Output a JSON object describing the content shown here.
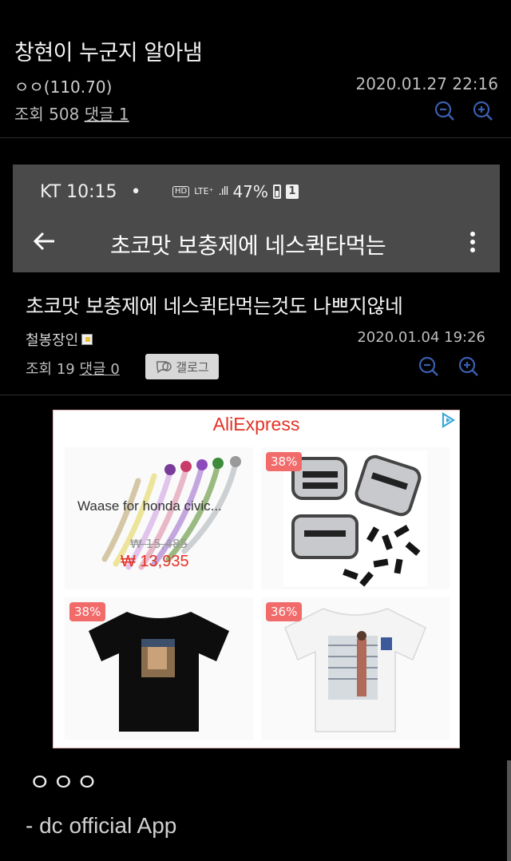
{
  "post": {
    "title": "창현이 누군지 알아냄",
    "author": "ㅇㅇ(110.70)",
    "date": "2020.01.27 22:16",
    "views_label": "조회 508",
    "comments_label": "댓글 1"
  },
  "embedded": {
    "status_bar": {
      "carrier_time": "KT 10:15",
      "dot": "•",
      "hd": "HD",
      "lte": "LTE⁺",
      "signal": ".ıll",
      "battery": "47%",
      "sim": "1"
    },
    "toolbar_title": "초코맛 보충제에 네스퀵타먹는",
    "post_title": "초코맛 보충제에 네스퀵타먹는것도 나쁘지않네",
    "author": "철봉장인",
    "date": "2020.01.04 19:26",
    "views_label": "조회 19",
    "comments_label": "댓글 0",
    "gallog_label": "갤로그"
  },
  "ad": {
    "brand": "AliExpress",
    "products": [
      {
        "name": "Waase for honda civic...",
        "old_price": "₩ 15,485",
        "price": "₩ 13,935"
      },
      {
        "discount": "38%"
      },
      {
        "discount": "38%"
      },
      {
        "discount": "36%"
      }
    ]
  },
  "body_text": "ㅇㅇㅇ",
  "footer": "- dc official App",
  "colors": {
    "accent": "#3a5fb0",
    "ad_red": "#e43225",
    "discount_badge": "#f26b6b"
  }
}
